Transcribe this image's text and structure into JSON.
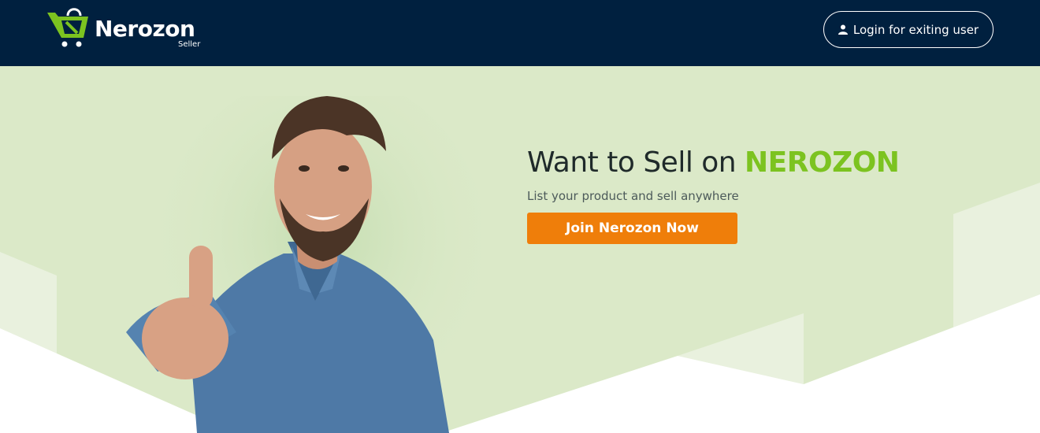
{
  "header": {
    "logo_text": "Nerozon",
    "logo_subtext": "Seller",
    "login_label": "Login for exiting user",
    "login_icon": "user-icon"
  },
  "hero": {
    "headline_prefix": "Want to Sell on ",
    "headline_brand": "NEROZON",
    "subheadline": "List your product and sell anywhere",
    "cta_label": "Join Nerozon Now",
    "image": "smiling-man-thumbs-up"
  },
  "colors": {
    "header_bg": "#00203f",
    "hero_bg": "#dbe9c8",
    "brand_green": "#7cc320",
    "cta_orange": "#ef7e0a"
  }
}
